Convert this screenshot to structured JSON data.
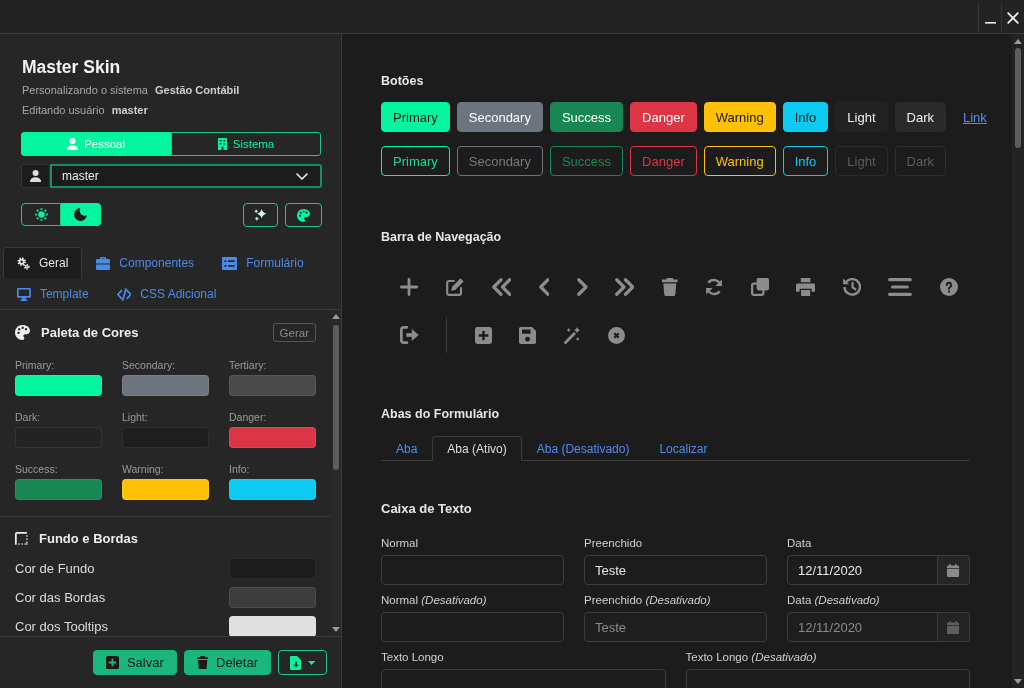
{
  "sidebar": {
    "title": "Master Skin",
    "subtitle": "Personalizando o sistema **Gestão Contábil**",
    "user_line": "Editando usuário **master**",
    "scope_toggle": [
      {
        "kind": "personal",
        "label": "Pessoal",
        "selected": true
      },
      {
        "kind": "system",
        "label": "Sistema",
        "selected": false
      }
    ],
    "user_select": {
      "value": "master"
    },
    "theme_toggle": [
      {
        "kind": "light",
        "selected": false
      },
      {
        "kind": "dark",
        "selected": true
      }
    ],
    "tabs": [
      {
        "kind": "general",
        "label": "Geral",
        "selected": true
      },
      {
        "kind": "components",
        "label": "Componentes",
        "selected": false
      },
      {
        "kind": "form",
        "label": "Formulário",
        "selected": false
      },
      {
        "kind": "template",
        "label": "Template",
        "selected": false
      },
      {
        "kind": "css",
        "label": "CSS Adicional",
        "selected": false
      }
    ],
    "palette": {
      "title": "Paleta de Cores",
      "generate_button": "Gerar",
      "colors": [
        {
          "label": "Primary:",
          "color": "#03f59d"
        },
        {
          "label": "Secondary:",
          "color": "#6c757d"
        },
        {
          "label": "Tertiary:",
          "color": "#4a4a4a"
        },
        {
          "label": "Dark:",
          "color": "#232323"
        },
        {
          "label": "Light:",
          "color": "#1e1e1e"
        },
        {
          "label": "Danger:",
          "color": "#dc3545"
        },
        {
          "label": "Success:",
          "color": "#198754"
        },
        {
          "label": "Warning:",
          "color": "#ffc107"
        },
        {
          "label": "Info:",
          "color": "#0dcaf0"
        }
      ]
    },
    "background_borders": {
      "title": "Fundo e Bordas",
      "rows": [
        {
          "label": "Cor de Fundo",
          "color": "#1c1c1c"
        },
        {
          "label": "Cor das Bordas",
          "color": "#3d3d3d"
        },
        {
          "label": "Cor dos Tooltips",
          "color": "#e0e0e0"
        }
      ]
    },
    "actions": [
      {
        "kind": "save",
        "label": "Salvar"
      },
      {
        "kind": "delete",
        "label": "Deletar"
      }
    ]
  },
  "main": {
    "buttons": {
      "title": "Botões",
      "solid": [
        {
          "kind": "primary",
          "label": "Primary"
        },
        {
          "kind": "secondary",
          "label": "Secondary"
        },
        {
          "kind": "success",
          "label": "Success"
        },
        {
          "kind": "danger",
          "label": "Danger"
        },
        {
          "kind": "warning",
          "label": "Warning"
        },
        {
          "kind": "info",
          "label": "Info"
        },
        {
          "kind": "light",
          "label": "Light"
        },
        {
          "kind": "dark",
          "label": "Dark"
        },
        {
          "kind": "link",
          "label": "Link"
        }
      ],
      "outline": [
        {
          "kind": "primary",
          "label": "Primary"
        },
        {
          "kind": "secondary",
          "label": "Secondary"
        },
        {
          "kind": "success",
          "label": "Success"
        },
        {
          "kind": "danger",
          "label": "Danger"
        },
        {
          "kind": "warning",
          "label": "Warning"
        },
        {
          "kind": "info",
          "label": "Info"
        },
        {
          "kind": "light",
          "label": "Light"
        },
        {
          "kind": "dark",
          "label": "Dark"
        }
      ]
    },
    "navigation_bar": {
      "title": "Barra de Navegação"
    },
    "form_tabs": {
      "title": "Abas do Formulário",
      "tabs": [
        {
          "label": "Aba",
          "selected": false
        },
        {
          "label": "Aba (Ativo)",
          "selected": true
        },
        {
          "label": "Aba (Desativado)",
          "selected": false
        },
        {
          "label": "Localizar",
          "selected": false
        }
      ]
    },
    "text_boxes": {
      "title": "Caixa de Texto",
      "fields": [
        {
          "kind": "text",
          "label": "Normal"
        },
        {
          "kind": "text",
          "label": "Preenchido",
          "value": "Teste",
          "disabled": false
        },
        {
          "kind": "date",
          "label": "Data",
          "value": "12/11/2020",
          "disabled": false
        },
        {
          "kind": "text",
          "label": "Normal *(Desativado)*"
        },
        {
          "kind": "text",
          "label": "Preenchido *(Desativado)*",
          "value": "Teste",
          "disabled": true
        },
        {
          "kind": "date",
          "label": "Data *(Desativado)*",
          "value": "12/11/2020",
          "disabled": true
        },
        {
          "kind": "textarea",
          "label": "Texto Longo"
        },
        {
          "kind": "textarea",
          "label": "Texto Longo *(Desativado)*"
        }
      ]
    }
  }
}
